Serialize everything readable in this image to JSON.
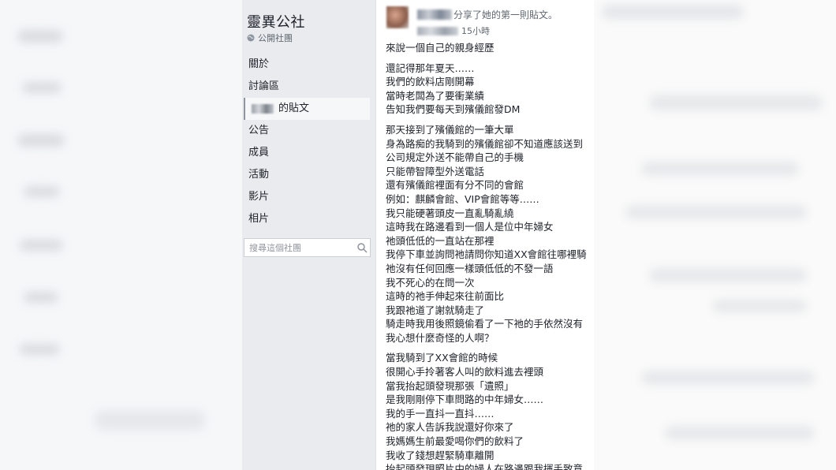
{
  "sidebar": {
    "group_name": "靈異公社",
    "group_type": "公開社團",
    "nav": [
      {
        "label": "關於"
      },
      {
        "label": "討論區"
      },
      {
        "label": "的貼文",
        "active": true
      },
      {
        "label": "公告"
      },
      {
        "label": "成員"
      },
      {
        "label": "活動"
      },
      {
        "label": "影片"
      },
      {
        "label": "相片"
      }
    ],
    "search_placeholder": "搜尋這個社團"
  },
  "post": {
    "author_action": "分享了她的第一則貼文。",
    "timestamp": "15小時",
    "paragraphs": [
      [
        "來說一個自己的親身經歷"
      ],
      [
        "還記得那年夏天……",
        "我們的飲料店剛開幕",
        "當時老闆為了要衝業績",
        "告知我們要每天到殯儀館發DM"
      ],
      [
        "那天接到了殯儀館的一筆大單",
        "身為路痴的我騎到的殯儀館卻不知道應該送到",
        "公司規定外送不能帶自己的手機",
        "只能帶智障型外送電話",
        "還有殯儀館裡面有分不同的會館",
        "例如：麒麟會館、VIP會館等等……",
        "我只能硬著頭皮一直亂騎亂繞",
        "這時我在路邊看到一個人是位中年婦女",
        "祂頭低低的一直站在那裡",
        "我停下車並詢問祂請問你知道XX會館往哪裡騎",
        "祂沒有任何回應一樣頭低低的不發一語",
        "我不死心的在問一次",
        "這時的祂手伸起來往前面比",
        "我跟祂道了謝就騎走了",
        "騎走時我用後照鏡偷看了一下祂的手依然沒有",
        "我心想什麼奇怪的人啊？"
      ],
      [
        "當我騎到了XX會館的時候",
        "很開心手拎著客人叫的飲料進去裡頭",
        "當我抬起頭發現那張「遺照」",
        "是我剛剛停下車問路的中年婦女……",
        "我的手一直抖一直抖……",
        "祂的家人告訴我說還好你來了",
        "我媽媽生前最愛喝你們的飲料了",
        "我收了錢想趕緊騎車離開",
        "抬起頭發現照片中的婦人在路邊跟我揮手致意"
      ]
    ]
  }
}
